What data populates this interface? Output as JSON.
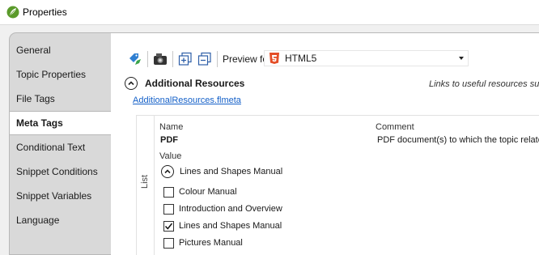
{
  "window": {
    "title": "Properties"
  },
  "sidebar": {
    "items": [
      {
        "label": "General",
        "active": false
      },
      {
        "label": "Topic Properties",
        "active": false
      },
      {
        "label": "File Tags",
        "active": false
      },
      {
        "label": "Meta Tags",
        "active": true
      },
      {
        "label": "Conditional Text",
        "active": false
      },
      {
        "label": "Snippet Conditions",
        "active": false
      },
      {
        "label": "Snippet Variables",
        "active": false
      },
      {
        "label": "Language",
        "active": false
      }
    ]
  },
  "toolbar": {
    "preview_label": "Preview for:",
    "preview_value": "HTML5"
  },
  "section": {
    "title": "Additional Resources",
    "description": "Links to useful resources suc",
    "file_link": "AdditionalResources.flmeta"
  },
  "grid": {
    "list_label": "List",
    "name_header": "Name",
    "comment_header": "Comment",
    "name_value": "PDF",
    "comment_value": "PDF document(s) to which the topic relate",
    "value_header": "Value",
    "value_selected": "Lines and Shapes Manual",
    "options": [
      {
        "label": "Colour Manual",
        "checked": false
      },
      {
        "label": "Introduction and Overview",
        "checked": false
      },
      {
        "label": "Lines and Shapes Manual",
        "checked": true
      },
      {
        "label": "Pictures Manual",
        "checked": false
      }
    ]
  },
  "colors": {
    "link": "#1460c8",
    "sidebar_bg": "#d9d9d9",
    "app_icon_green": "#5a9a2a",
    "html5_red": "#e44d26"
  }
}
